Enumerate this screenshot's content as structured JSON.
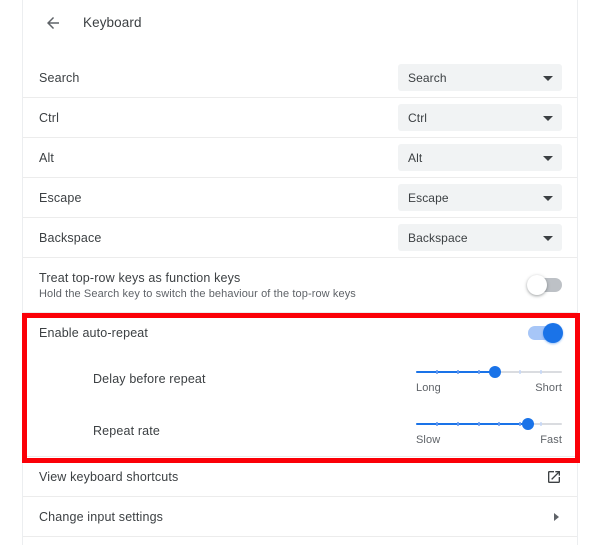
{
  "header": {
    "back_icon": "arrow-left-icon",
    "title": "Keyboard"
  },
  "rows": [
    {
      "label": "Search",
      "value": "Search"
    },
    {
      "label": "Ctrl",
      "value": "Ctrl"
    },
    {
      "label": "Alt",
      "value": "Alt"
    },
    {
      "label": "Escape",
      "value": "Escape"
    },
    {
      "label": "Backspace",
      "value": "Backspace"
    }
  ],
  "function_keys": {
    "label": "Treat top-row keys as function keys",
    "sublabel": "Hold the Search key to switch the behaviour of the top-row keys",
    "toggle_state": "off"
  },
  "auto_repeat": {
    "label": "Enable auto-repeat",
    "toggle_state": "on"
  },
  "delay_before_repeat": {
    "label": "Delay before repeat",
    "min_label": "Long",
    "max_label": "Short",
    "value_percent": 54
  },
  "repeat_rate": {
    "label": "Repeat rate",
    "min_label": "Slow",
    "max_label": "Fast",
    "value_percent": 77
  },
  "view_shortcuts": {
    "label": "View keyboard shortcuts",
    "icon": "external-link-icon"
  },
  "change_input": {
    "label": "Change input settings",
    "icon": "chevron-right-icon"
  },
  "colors": {
    "accent": "#1a73e8",
    "highlight": "#fb0007",
    "control_bg": "#f1f3f4",
    "text_primary": "#3c4043",
    "text_secondary": "#5f6368"
  }
}
